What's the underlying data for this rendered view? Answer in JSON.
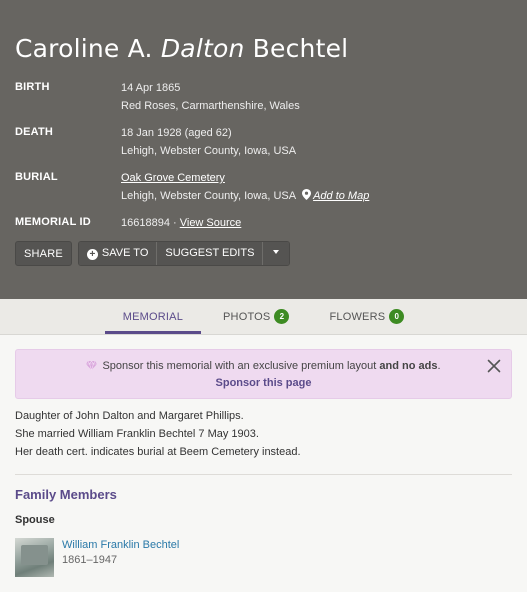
{
  "header": {
    "first": "Caroline A.",
    "maiden": "Dalton",
    "last": "Bechtel"
  },
  "facts": {
    "birth": {
      "label": "BIRTH",
      "date": "14 Apr 1865",
      "place": "Red Roses, Carmarthenshire, Wales"
    },
    "death": {
      "label": "DEATH",
      "date": "18 Jan 1928 (aged 62)",
      "place": "Lehigh, Webster County, Iowa, USA"
    },
    "burial": {
      "label": "BURIAL",
      "cemetery": "Oak Grove Cemetery",
      "place": "Lehigh, Webster County, Iowa, USA",
      "map_link": "Add to Map"
    },
    "memorial_id": {
      "label": "MEMORIAL ID",
      "value": "16618894",
      "sep": " · ",
      "view_source": "View Source"
    }
  },
  "buttons": {
    "share": "SHARE",
    "save": "SAVE TO",
    "suggest": "SUGGEST EDITS"
  },
  "tabs": [
    {
      "label": "MEMORIAL"
    },
    {
      "label": "PHOTOS",
      "count": "2"
    },
    {
      "label": "FLOWERS",
      "count": "0"
    }
  ],
  "sponsor": {
    "text_pre": "Sponsor this memorial with an exclusive premium layout ",
    "text_bold": "and no ads",
    "text_post": ".",
    "cta": "Sponsor this page"
  },
  "bio": [
    "Daughter of John Dalton and Margaret Phillips.",
    "She married William Franklin Bechtel 7 May 1903.",
    "Her death cert. indicates burial at Beem Cemetery instead."
  ],
  "family": {
    "title": "Family Members",
    "spouse_heading": "Spouse",
    "spouse": {
      "name": "William Franklin Bechtel",
      "dates": "1861–1947"
    }
  },
  "colors": {
    "hero": "#676561",
    "accent": "#5b4b8a",
    "badge": "#3d8b22",
    "sponsor_bg": "#efdaf0",
    "link": "#2a79a8"
  }
}
